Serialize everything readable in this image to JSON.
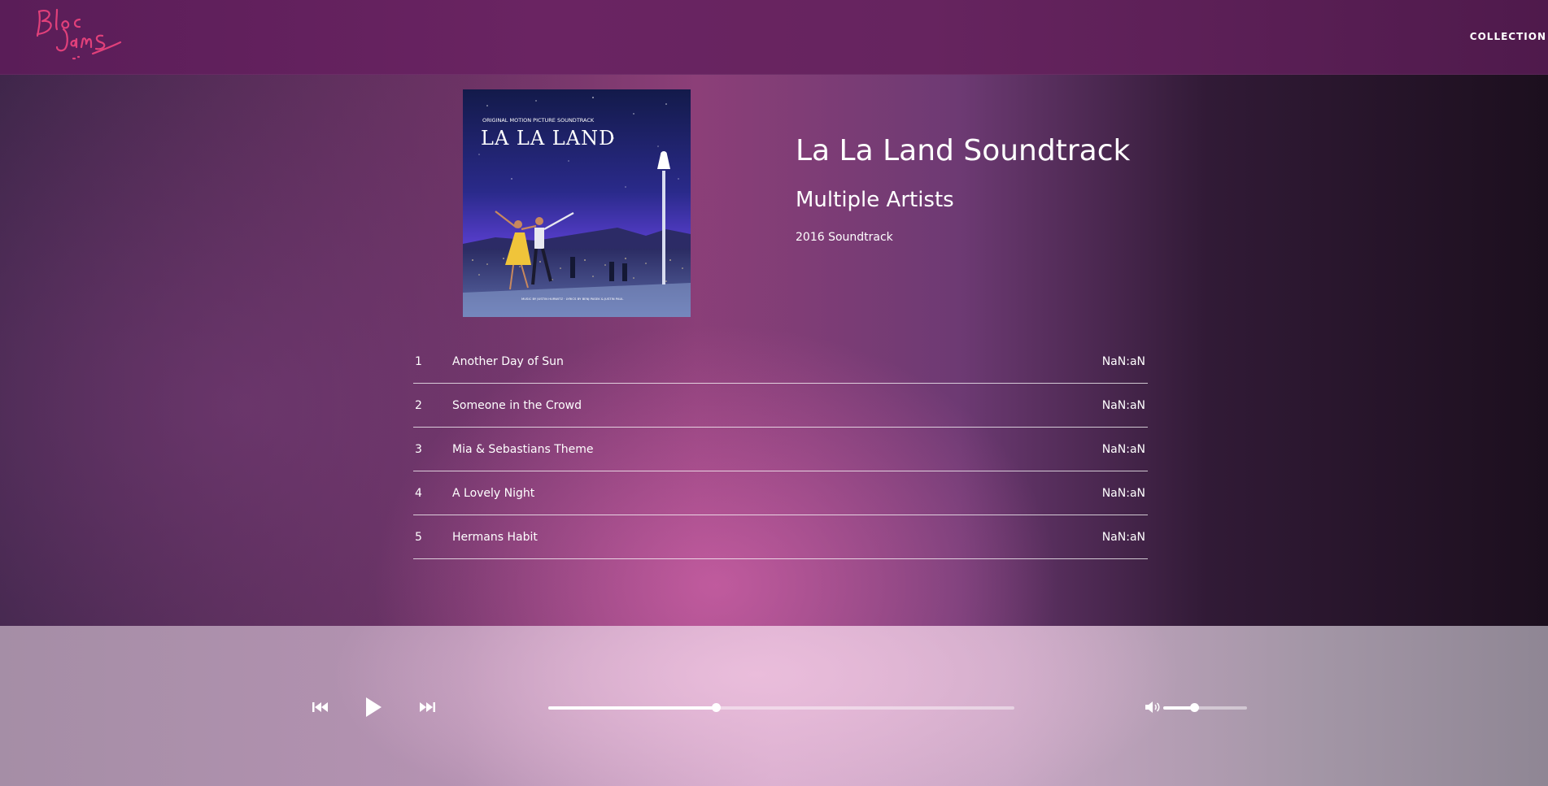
{
  "app": {
    "logo_text": "Bloc Jams"
  },
  "nav": {
    "collection_label": "COLLECTION"
  },
  "album": {
    "title": "La La Land Soundtrack",
    "artist": "Multiple Artists",
    "release_info": "2016 Soundtrack",
    "cover": {
      "top_caption": "ORIGINAL MOTION PICTURE SOUNDTRACK",
      "title": "LA LA LAND",
      "credits": "MUSIC BY JUSTIN HURWITZ · LYRICS BY BENJ PASEK & JUSTIN PAUL"
    }
  },
  "songs": [
    {
      "number": "1",
      "title": "Another Day of Sun",
      "duration": "NaN:aN"
    },
    {
      "number": "2",
      "title": "Someone in the Crowd",
      "duration": "NaN:aN"
    },
    {
      "number": "3",
      "title": "Mia & Sebastians Theme",
      "duration": "NaN:aN"
    },
    {
      "number": "4",
      "title": "A Lovely Night",
      "duration": "NaN:aN"
    },
    {
      "number": "5",
      "title": "Hermans Habit",
      "duration": "NaN:aN"
    }
  ],
  "player": {
    "seek_fraction": 0.36,
    "volume_fraction": 0.37,
    "icons": {
      "previous": "previous-icon",
      "play": "play-icon",
      "next": "next-icon",
      "volume": "volume-icon"
    }
  },
  "colors": {
    "logo_pink": "#e0407a",
    "header_bg": "#5f2160"
  }
}
